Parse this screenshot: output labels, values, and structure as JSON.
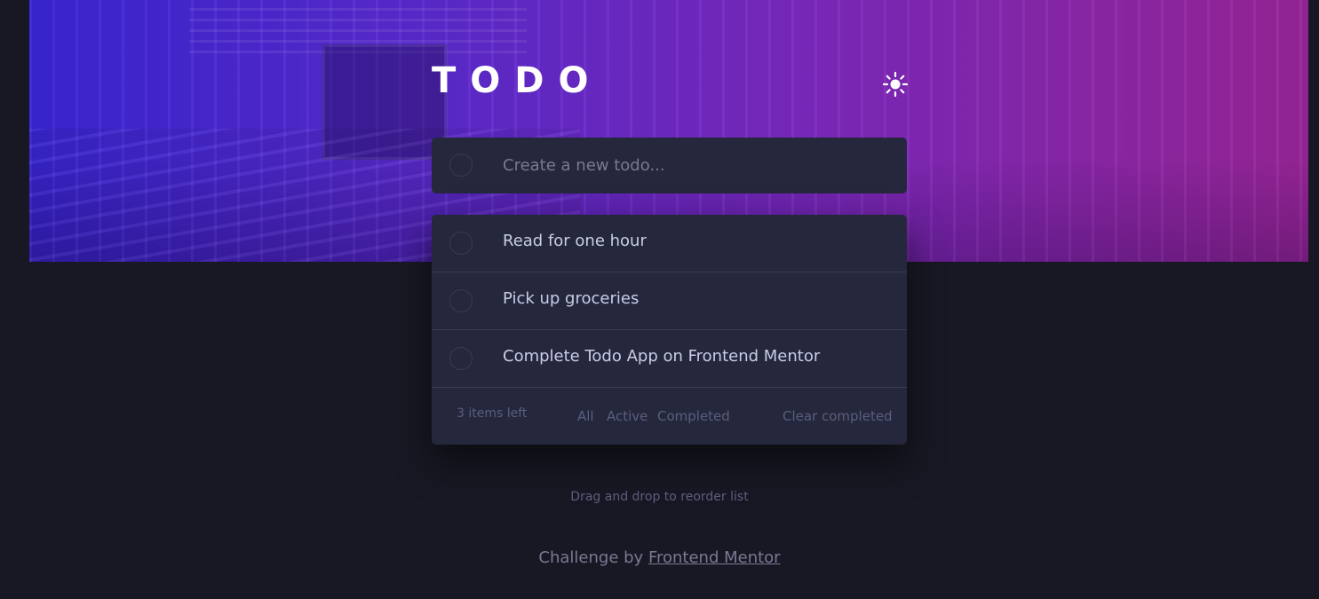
{
  "header": {
    "title": "TODO",
    "theme_icon": "sun-icon"
  },
  "new_todo": {
    "placeholder": "Create a new todo..."
  },
  "todos": [
    {
      "text": "Read for one hour",
      "completed": false
    },
    {
      "text": "Pick up groceries",
      "completed": false
    },
    {
      "text": "Complete Todo App on Frontend Mentor",
      "completed": false
    }
  ],
  "footer": {
    "items_left": "3 items left",
    "filters": [
      "All",
      "Active",
      "Completed"
    ],
    "clear_label": "Clear completed"
  },
  "hint": "Drag and drop to reorder list",
  "attribution": {
    "prefix": "Challenge by ",
    "link_text": "Frontend Mentor"
  },
  "colors": {
    "background": "#181824",
    "card": "#25273c",
    "text": "#cacde8",
    "muted": "#5b5e7e",
    "gradient_start": "#3a26d6",
    "gradient_end": "#9a2699"
  }
}
